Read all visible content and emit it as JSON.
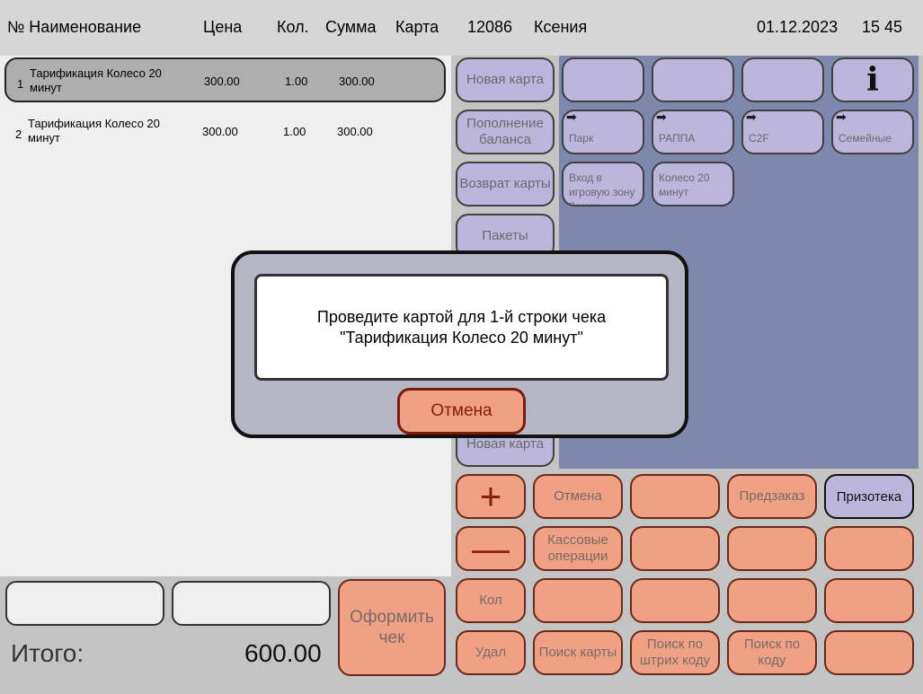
{
  "header": {
    "col_num_name": "№ Наименование",
    "col_price": "Цена",
    "col_qty": "Кол.",
    "col_sum": "Сумма",
    "col_card": "Карта",
    "terminal_id": "12086",
    "cashier": "Ксения",
    "date": "01.12.2023",
    "time": "15 45"
  },
  "receipt": {
    "rows": [
      {
        "num": "1",
        "name": "Тарификация Колесо 20 минут",
        "price": "300.00",
        "qty": "1.00",
        "sum": "300.00"
      },
      {
        "num": "2",
        "name": "Тарификация Колесо 20 минут",
        "price": "300.00",
        "qty": "1.00",
        "sum": "300.00"
      }
    ]
  },
  "categories": {
    "new_card": "Новая карта",
    "top_up": "Пополнение баланса",
    "return_card": "Возврат карты",
    "packages": "Пакеты",
    "new_card_2": "Новая карта"
  },
  "tiles": {
    "park": "Парк",
    "rappa": "РАППА",
    "c2f": "C2F",
    "family": "Семейные",
    "game_zone": "Вход в игровую зону Замок",
    "wheel": "Колесо 20 минут"
  },
  "ops": {
    "cancel": "Отмена",
    "preorder": "Предзаказ",
    "prize_shop": "Призотека",
    "cash_ops": "Кассовые операции",
    "qty": "Кол",
    "delete": "Удал",
    "find_card": "Поиск карты",
    "find_barcode": "Поиск по штрих коду",
    "find_code": "Поиск по коду",
    "checkout": "Оформить чек",
    "plus": "+",
    "minus": "—"
  },
  "totals": {
    "label": "Итого:",
    "value": "600.00"
  },
  "modal": {
    "line1": "Проведите картой для 1-й строки чека",
    "line2": "\"Тарификация Колесо 20 минут\"",
    "cancel": "Отмена"
  },
  "colors": {
    "category_bg": "#bcb6dc",
    "operation_bg": "#f0a185",
    "tile_area_bg": "#7e88ad",
    "modal_bg": "#b6b6c4"
  }
}
